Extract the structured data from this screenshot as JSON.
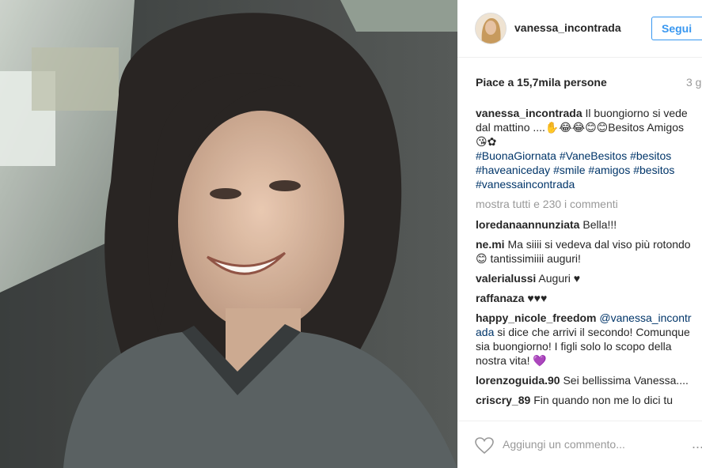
{
  "post": {
    "photo_alt": "",
    "author": "vanessa_incontrada",
    "follow_label": "Segui",
    "likes": "Piace a 15,7mila persone",
    "time": "3 g",
    "caption_user": "vanessa_incontrada",
    "caption_text": "Il buongiorno si vede dal mattino ....✋😂😂😊😊Besitos Amigos😘✿",
    "caption_tags": "#BuonaGiornata #VaneBesitos #besitos #haveaniceday #smile #amigos #besitos #vanessaincontrada",
    "show_all_comments": "mostra tutti e 230 i commenti",
    "add_comment_placeholder": "Aggiungi un commento...",
    "more_icon": "..."
  },
  "comments": [
    {
      "user": "loredanaannunziata",
      "text": "Bella!!!"
    },
    {
      "user": "ne.mi",
      "text": "Ma siiii si vedeva dal viso più rotondo😊 tantissimiiii auguri!"
    },
    {
      "user": "valerialussi",
      "text": "Auguri ♥"
    },
    {
      "user": "raffanaza",
      "text": "♥♥♥"
    },
    {
      "user": "happy_nicole_freedom",
      "mention": "@vanessa_incontrada",
      "text": "si dice che arrivi il secondo! Comunque sia buongiorno! I figli solo lo scopo della nostra vita! 💜"
    },
    {
      "user": "lorenzoguida.90",
      "text": "Sei bellissima Vanessa...."
    },
    {
      "user": "criscry_89",
      "text": "Fin quando non me lo dici tu"
    }
  ],
  "colors": {
    "accent": "#3897f0",
    "hashtag": "#003569",
    "muted": "#999999"
  },
  "icons": [
    "heart-icon",
    "more-options-icon"
  ]
}
